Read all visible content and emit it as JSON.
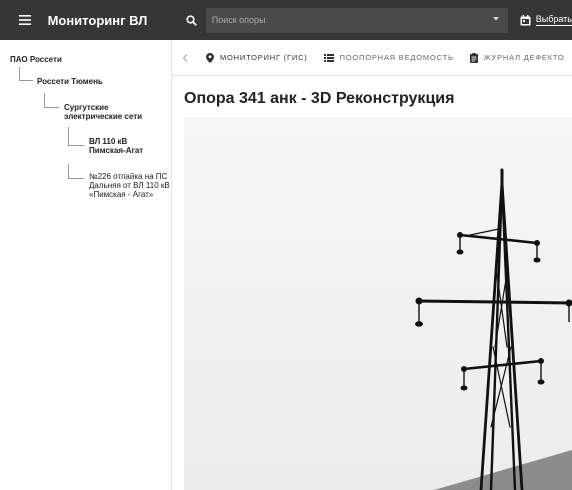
{
  "header": {
    "title": "Мониторинг ВЛ",
    "search_placeholder": "Поиск опоры",
    "pick_label": "Выбрать"
  },
  "sidebar": {
    "items": [
      {
        "label": "ПАО Россети"
      },
      {
        "label": "Россети Тюмень"
      },
      {
        "label": "Сургутские электрические сети"
      },
      {
        "label": "ВЛ 110 кВ Пимская-Агат"
      },
      {
        "label": "№226 отпайка на ПС Дальняя от ВЛ 110 кВ «Пимская - Агат»"
      }
    ]
  },
  "tabs": [
    {
      "label": "МОНИТОРИНГ (ГИС)",
      "icon": "map-pin-icon",
      "active": true
    },
    {
      "label": "ПООПОРНАЯ ВЕДОМОСТЬ",
      "icon": "list-icon",
      "active": false
    },
    {
      "label": "ЖУРНАЛ ДЕФЕКТО",
      "icon": "clipboard-icon",
      "active": false
    }
  ],
  "main": {
    "title": "Опора 341 анк - 3D Реконструкция"
  },
  "colors": {
    "topbar": "#363636",
    "search_bg": "#4a4a4a",
    "viewer_bg": "#f3f3f3",
    "ground": "#8c8c8c",
    "tower": "#111111"
  }
}
